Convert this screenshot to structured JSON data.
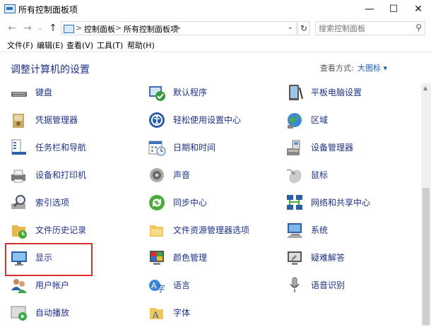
{
  "window": {
    "title": "所有控制面板项",
    "buttons": {
      "minimize": "—",
      "maximize": "☐",
      "close": "✕"
    }
  },
  "address": {
    "breadcrumb": [
      "控制面板",
      "所有控制面板项"
    ],
    "separator": ">",
    "search_placeholder": "搜索控制面板"
  },
  "menu": [
    "文件(F)",
    "编辑(E)",
    "查看(V)",
    "工具(T)",
    "帮助(H)"
  ],
  "main": {
    "heading": "调整计算机的设置",
    "view_by_label": "查看方式:",
    "view_by_value": "大图标 ▾"
  },
  "items": [
    {
      "label": "键盘",
      "icon": "keyboard-icon"
    },
    {
      "label": "默认程序",
      "icon": "default-programs-icon"
    },
    {
      "label": "平板电脑设置",
      "icon": "tablet-pc-settings-icon"
    },
    {
      "label": "凭据管理器",
      "icon": "credential-manager-icon"
    },
    {
      "label": "轻松使用设置中心",
      "icon": "ease-of-access-icon"
    },
    {
      "label": "区域",
      "icon": "region-icon"
    },
    {
      "label": "任务栏和导航",
      "icon": "taskbar-icon"
    },
    {
      "label": "日期和时间",
      "icon": "date-time-icon"
    },
    {
      "label": "设备管理器",
      "icon": "device-manager-icon"
    },
    {
      "label": "设备和打印机",
      "icon": "devices-printers-icon"
    },
    {
      "label": "声音",
      "icon": "sound-icon"
    },
    {
      "label": "鼠标",
      "icon": "mouse-icon"
    },
    {
      "label": "索引选项",
      "icon": "indexing-options-icon"
    },
    {
      "label": "同步中心",
      "icon": "sync-center-icon"
    },
    {
      "label": "网络和共享中心",
      "icon": "network-sharing-icon"
    },
    {
      "label": "文件历史记录",
      "icon": "file-history-icon"
    },
    {
      "label": "文件资源管理器选项",
      "icon": "file-explorer-options-icon"
    },
    {
      "label": "系统",
      "icon": "system-icon"
    },
    {
      "label": "显示",
      "icon": "display-icon"
    },
    {
      "label": "颜色管理",
      "icon": "color-management-icon"
    },
    {
      "label": "疑难解答",
      "icon": "troubleshooting-icon"
    },
    {
      "label": "用户帐户",
      "icon": "user-accounts-icon"
    },
    {
      "label": "语言",
      "icon": "language-icon"
    },
    {
      "label": "语音识别",
      "icon": "speech-recognition-icon"
    },
    {
      "label": "自动播放",
      "icon": "autoplay-icon"
    },
    {
      "label": "字体",
      "icon": "fonts-icon"
    }
  ]
}
